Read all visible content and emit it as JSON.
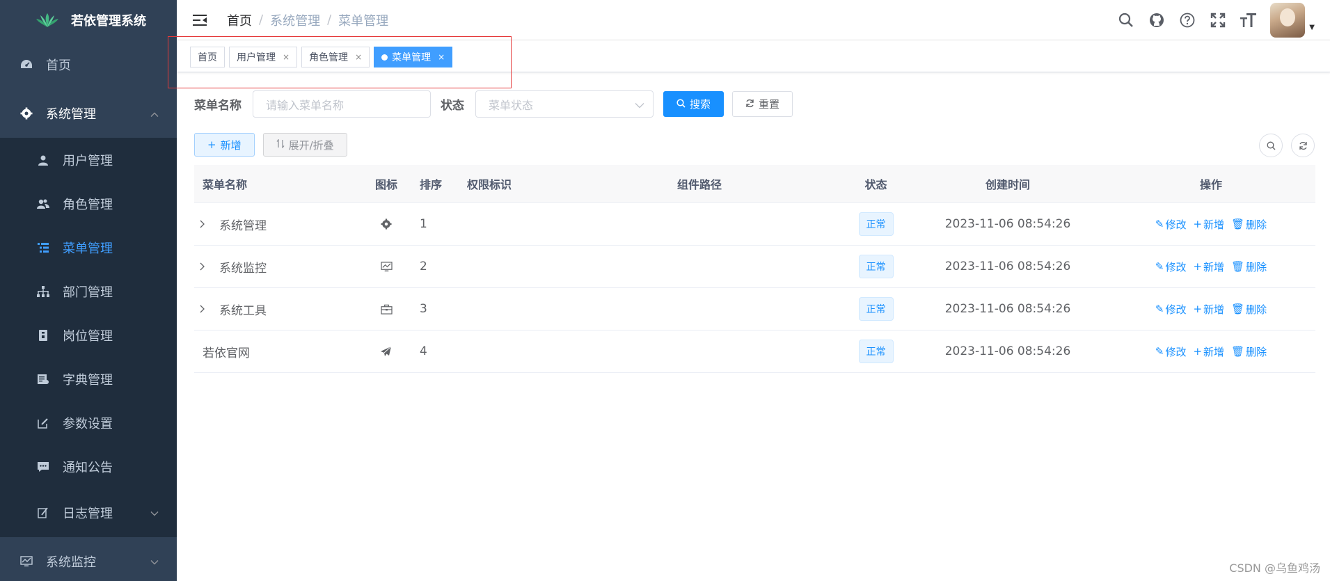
{
  "app": {
    "title": "若依管理系统"
  },
  "sidebar": {
    "items": [
      {
        "label": "首页",
        "icon": "dashboard-icon"
      },
      {
        "label": "系统管理",
        "icon": "gear-icon"
      }
    ],
    "sub_items": [
      {
        "label": "用户管理",
        "icon": "user-icon"
      },
      {
        "label": "角色管理",
        "icon": "peoples-icon"
      },
      {
        "label": "菜单管理",
        "icon": "tree-table-icon"
      },
      {
        "label": "部门管理",
        "icon": "tree-icon"
      },
      {
        "label": "岗位管理",
        "icon": "post-icon"
      },
      {
        "label": "字典管理",
        "icon": "dict-icon"
      },
      {
        "label": "参数设置",
        "icon": "edit-icon"
      },
      {
        "label": "通知公告",
        "icon": "message-icon"
      },
      {
        "label": "日志管理",
        "icon": "log-icon"
      }
    ],
    "bottom": {
      "label": "系统监控",
      "icon": "monitor-icon"
    },
    "colors": {
      "bg": "#304156",
      "sub_bg": "#1f2d3d",
      "active": "#409eff"
    }
  },
  "breadcrumb": [
    "首页",
    "系统管理",
    "菜单管理"
  ],
  "tags": [
    {
      "label": "首页",
      "closable": false
    },
    {
      "label": "用户管理",
      "closable": true
    },
    {
      "label": "角色管理",
      "closable": true
    },
    {
      "label": "菜单管理",
      "closable": true,
      "active": true
    }
  ],
  "tag_close": "×",
  "search": {
    "name_label": "菜单名称",
    "name_placeholder": "请输入菜单名称",
    "status_label": "状态",
    "status_placeholder": "菜单状态",
    "search_button": "搜索",
    "reset_button": "重置"
  },
  "toolbar": {
    "add_button": "新增",
    "toggle_button": "展开/折叠"
  },
  "table": {
    "headers": {
      "name": "菜单名称",
      "icon": "图标",
      "order": "排序",
      "perms": "权限标识",
      "path": "组件路径",
      "status": "状态",
      "time": "创建时间",
      "ops": "操作"
    },
    "rows": [
      {
        "name": "系统管理",
        "icon": "gear-icon",
        "order": "1",
        "perms": "",
        "path": "",
        "status": "正常",
        "time": "2023-11-06 08:54:26",
        "expandable": true
      },
      {
        "name": "系统监控",
        "icon": "monitor-icon",
        "order": "2",
        "perms": "",
        "path": "",
        "status": "正常",
        "time": "2023-11-06 08:54:26",
        "expandable": true
      },
      {
        "name": "系统工具",
        "icon": "toolbox-icon",
        "order": "3",
        "perms": "",
        "path": "",
        "status": "正常",
        "time": "2023-11-06 08:54:26",
        "expandable": true
      },
      {
        "name": "若依官网",
        "icon": "send-icon",
        "order": "4",
        "perms": "",
        "path": "",
        "status": "正常",
        "time": "2023-11-06 08:54:26",
        "expandable": false
      }
    ],
    "op_labels": {
      "edit": "修改",
      "add": "新增",
      "delete": "删除"
    }
  },
  "watermark": "CSDN @乌鱼鸡汤"
}
